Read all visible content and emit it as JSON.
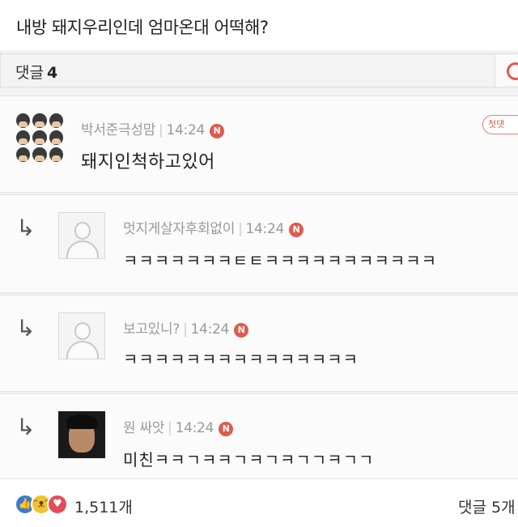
{
  "post": {
    "title": "내방 돼지우리인데 엄마온대 어떡해?"
  },
  "comments_header": {
    "label": "댓글",
    "count": "4"
  },
  "first_badge": "첫댓",
  "new_marker": "N",
  "comments": [
    {
      "author": "박서준극성맘",
      "time": "14:24",
      "text": "돼지인척하고있어"
    },
    {
      "author": "멋지게살자후회없이",
      "time": "14:24",
      "text": "ㅋㅋㅋㅋㅋㅋㅋㅌㅌㅋㅋㅋㅋㅋㅋㅋㅋㅋㅋㅋ"
    },
    {
      "author": "보고있니?",
      "time": "14:24",
      "text": "ㅋㅋㅋㅋㅋㅋㅋㅋㅋㅋㅋㅋㅋㅋㅋ"
    },
    {
      "author": "원 싸앗",
      "time": "14:24",
      "text": "미친ㅋㅋㄱㅋㅋㄱㅋㄱㅋㄱㄱㅋㄱㄱ"
    }
  ],
  "reply_arrow": "↳",
  "footer": {
    "reaction_icons": [
      "like-icon",
      "haha-icon",
      "love-icon"
    ],
    "like_count": "1,511개",
    "comments_label": "댓글 5개"
  }
}
